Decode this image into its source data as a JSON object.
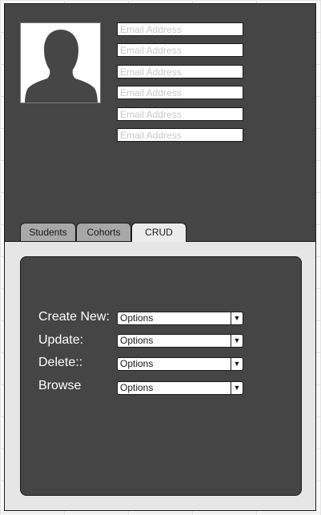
{
  "profile": {
    "avatar_icon": "person-silhouette-icon",
    "email_fields": [
      {
        "placeholder": "Email Address"
      },
      {
        "placeholder": "Email Address"
      },
      {
        "placeholder": "Email Address"
      },
      {
        "placeholder": "Email Address"
      },
      {
        "placeholder": "Email Address"
      },
      {
        "placeholder": "Email Address"
      }
    ]
  },
  "tabs": [
    {
      "label": "Students",
      "active": false
    },
    {
      "label": "Cohorts",
      "active": false
    },
    {
      "label": "CRUD",
      "active": true
    }
  ],
  "crud": {
    "rows": [
      {
        "label": "Create New:",
        "selected": "Options"
      },
      {
        "label": "Update:",
        "selected": "Options"
      },
      {
        "label": "Delete::",
        "selected": "Options"
      },
      {
        "label": "Browse",
        "selected": "Options"
      }
    ],
    "dropdown_icon": "triangle-down-icon"
  },
  "colors": {
    "dark_panel": "#454545",
    "tab_inactive": "#a8a8a8",
    "tab_active": "#ececec",
    "body_panel": "#e6e6e6"
  }
}
